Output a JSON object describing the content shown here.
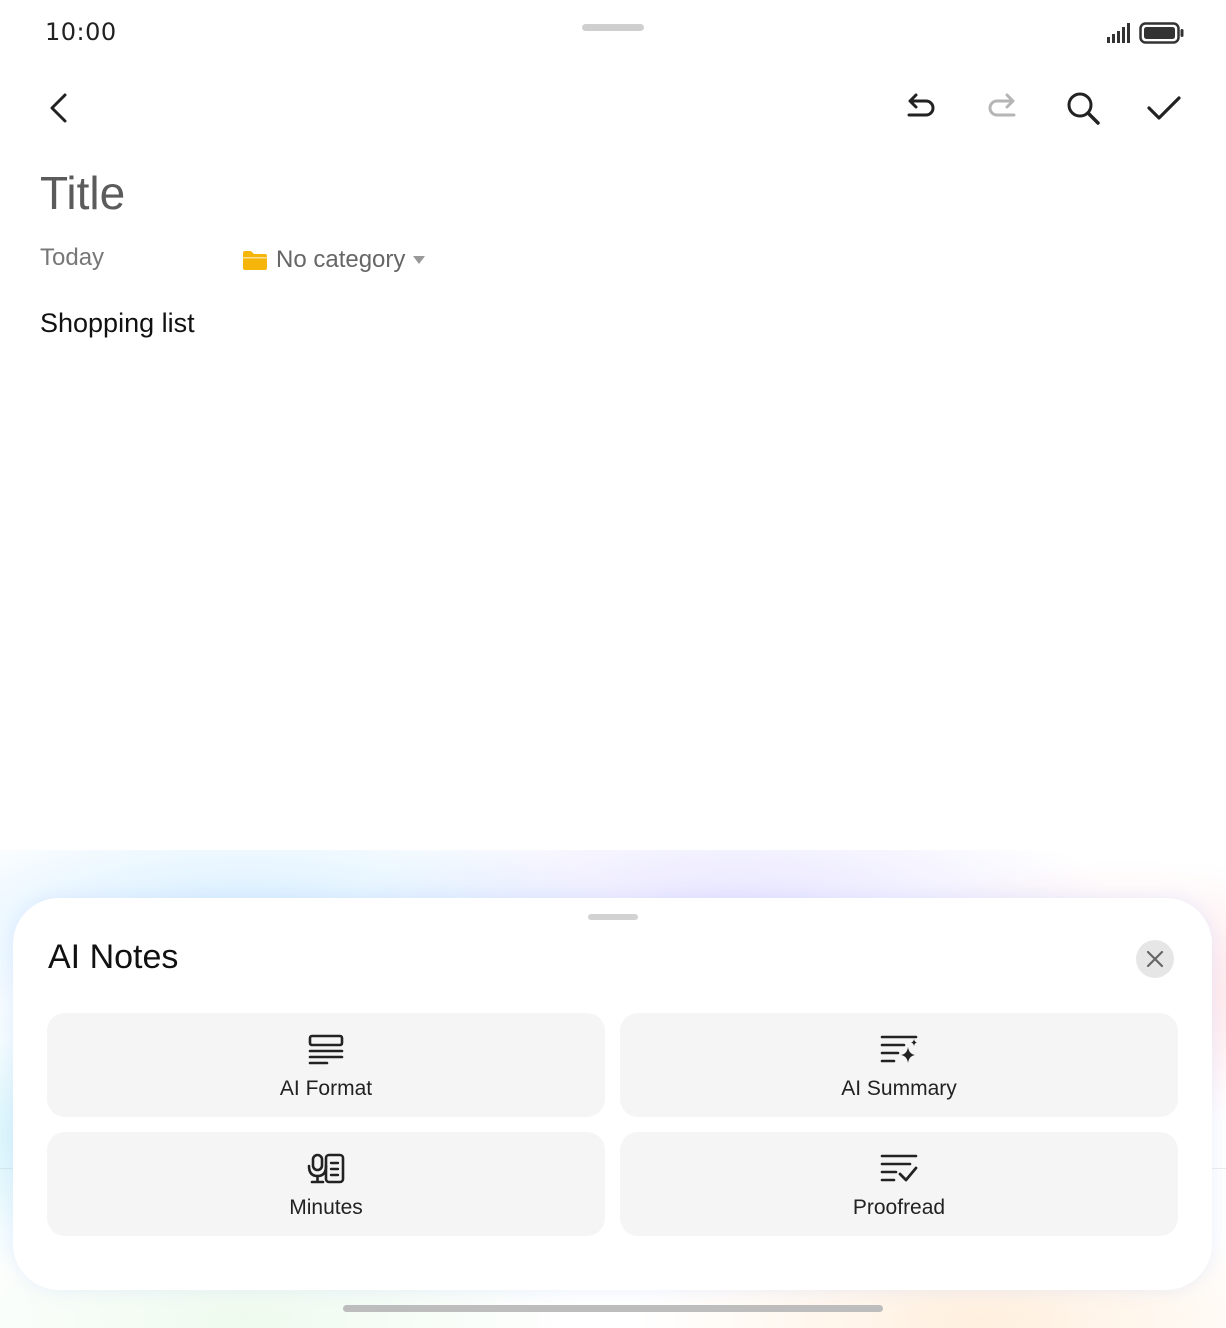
{
  "status_bar": {
    "time": "10:00",
    "icons": [
      "signal-icon",
      "battery-icon"
    ]
  },
  "toolbar": {
    "buttons": [
      {
        "name": "back",
        "icon": "chevron-left-icon"
      },
      {
        "name": "undo",
        "icon": "undo-icon"
      },
      {
        "name": "redo",
        "icon": "redo-icon",
        "state": "disabled"
      },
      {
        "name": "search",
        "icon": "search-icon"
      },
      {
        "name": "done",
        "icon": "check-icon"
      }
    ]
  },
  "note": {
    "title": "Title",
    "date": "Today",
    "category": "No category",
    "body": "Shopping list"
  },
  "ai_sheet": {
    "title": "AI Notes",
    "actions": [
      {
        "label": "AI Format",
        "icon": "format-lines-icon"
      },
      {
        "label": "AI Summary",
        "icon": "summary-sparkle-icon"
      },
      {
        "label": "Minutes",
        "icon": "minutes-mic-icon"
      },
      {
        "label": "Proofread",
        "icon": "proofread-check-icon"
      }
    ]
  },
  "colors": {
    "folder": "#F5B50A",
    "disabled_icon": "#B5B5B5",
    "card_bg": "#F5F5F5"
  }
}
